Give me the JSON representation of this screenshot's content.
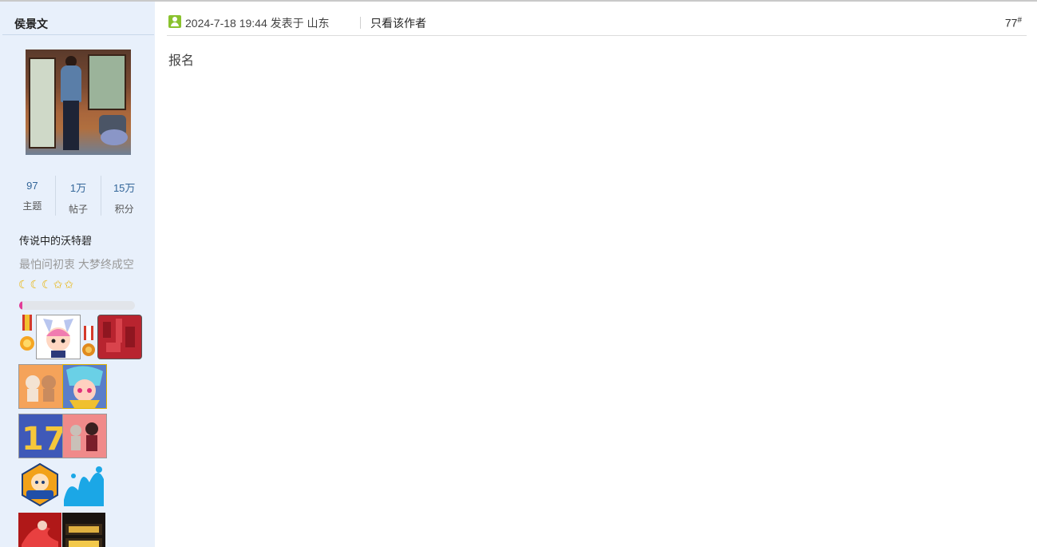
{
  "colors": {
    "sidebar_bg": "#e8f0fb",
    "stat_number": "#336699",
    "signature": "#999999",
    "progress_fill": "#e23b97",
    "rank_icon": "#e9b200",
    "user_icon": "#8ac22e"
  },
  "author": {
    "name": "侯景文",
    "stats": [
      {
        "value": "97",
        "label": "主题"
      },
      {
        "value": "1万",
        "label": "帖子"
      },
      {
        "value": "15万",
        "label": "积分"
      }
    ],
    "group": "传说中的沃特碧",
    "signature": "最怕问初衷 大梦终成空",
    "rank_icons": [
      "moon-icon",
      "moon-icon",
      "moon-icon",
      "star-icon",
      "star-icon"
    ],
    "level_progress": 0.02
  },
  "post": {
    "meta": "2024-7-18 19:44 发表于 山东",
    "only_author": "只看该作者",
    "floor": "77",
    "floor_mark": "#",
    "content": "报名"
  }
}
